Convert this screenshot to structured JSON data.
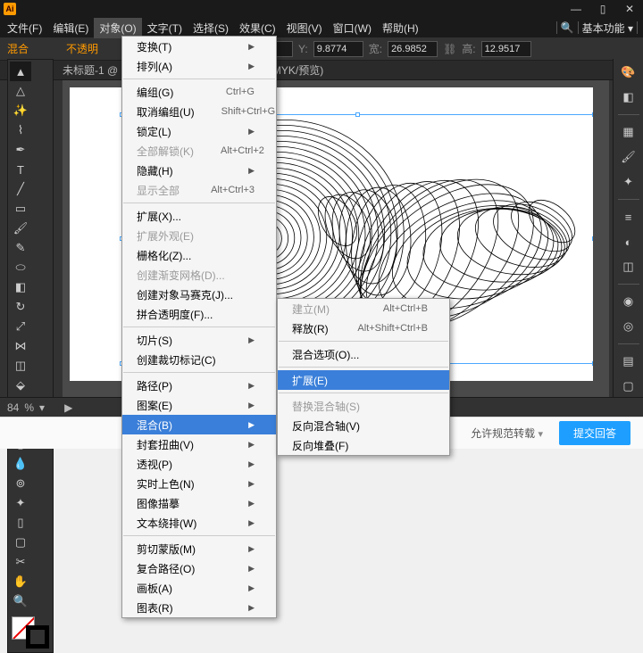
{
  "app": {
    "logo": "Ai"
  },
  "menubar": {
    "items": [
      "文件(F)",
      "编辑(E)",
      "对象(O)",
      "文字(T)",
      "选择(S)",
      "效果(C)",
      "视图(V)",
      "窗口(W)",
      "帮助(H)"
    ],
    "workspace": "基本功能"
  },
  "winctl": {
    "min": "—",
    "max": "▯",
    "close": "✕"
  },
  "optbar": {
    "blend_label": "混合",
    "opacity_label": "不透明",
    "x": "0805",
    "y": "9.8774",
    "w_lbl": "宽:",
    "w": "26.9852",
    "h_lbl": "高:",
    "h": "12.9517"
  },
  "doctab": {
    "title": "未标题-1 @",
    "view": "(CMYK/预览)"
  },
  "status": {
    "zoom": "84",
    "tool": "▶"
  },
  "menu1": [
    {
      "t": "row",
      "label": "变换(T)",
      "arrow": true
    },
    {
      "t": "row",
      "label": "排列(A)",
      "arrow": true
    },
    {
      "t": "sep"
    },
    {
      "t": "row",
      "label": "编组(G)",
      "sc": "Ctrl+G"
    },
    {
      "t": "row",
      "label": "取消编组(U)",
      "sc": "Shift+Ctrl+G"
    },
    {
      "t": "row",
      "label": "锁定(L)",
      "arrow": true
    },
    {
      "t": "row",
      "label": "全部解锁(K)",
      "disabled": true,
      "sc": "Alt+Ctrl+2"
    },
    {
      "t": "row",
      "label": "隐藏(H)",
      "arrow": true
    },
    {
      "t": "row",
      "label": "显示全部",
      "disabled": true,
      "sc": "Alt+Ctrl+3"
    },
    {
      "t": "sep"
    },
    {
      "t": "row",
      "label": "扩展(X)..."
    },
    {
      "t": "row",
      "label": "扩展外观(E)",
      "disabled": true
    },
    {
      "t": "row",
      "label": "栅格化(Z)..."
    },
    {
      "t": "row",
      "label": "创建渐变网格(D)...",
      "disabled": true
    },
    {
      "t": "row",
      "label": "创建对象马赛克(J)..."
    },
    {
      "t": "row",
      "label": "拼合透明度(F)..."
    },
    {
      "t": "sep"
    },
    {
      "t": "row",
      "label": "切片(S)",
      "arrow": true
    },
    {
      "t": "row",
      "label": "创建裁切标记(C)"
    },
    {
      "t": "sep"
    },
    {
      "t": "row",
      "label": "路径(P)",
      "arrow": true
    },
    {
      "t": "row",
      "label": "图案(E)",
      "arrow": true
    },
    {
      "t": "row",
      "label": "混合(B)",
      "arrow": true,
      "hover": true
    },
    {
      "t": "row",
      "label": "封套扭曲(V)",
      "arrow": true
    },
    {
      "t": "row",
      "label": "透视(P)",
      "arrow": true
    },
    {
      "t": "row",
      "label": "实时上色(N)",
      "arrow": true
    },
    {
      "t": "row",
      "label": "图像描摹",
      "arrow": true
    },
    {
      "t": "row",
      "label": "文本绕排(W)",
      "arrow": true
    },
    {
      "t": "sep"
    },
    {
      "t": "row",
      "label": "剪切蒙版(M)",
      "arrow": true
    },
    {
      "t": "row",
      "label": "复合路径(O)",
      "arrow": true
    },
    {
      "t": "row",
      "label": "画板(A)",
      "arrow": true
    },
    {
      "t": "row",
      "label": "图表(R)",
      "arrow": true
    }
  ],
  "menu2": [
    {
      "t": "row",
      "label": "建立(M)",
      "disabled": true,
      "sc": "Alt+Ctrl+B"
    },
    {
      "t": "row",
      "label": "释放(R)",
      "sc": "Alt+Shift+Ctrl+B"
    },
    {
      "t": "sep"
    },
    {
      "t": "row",
      "label": "混合选项(O)..."
    },
    {
      "t": "sep"
    },
    {
      "t": "row",
      "label": "扩展(E)",
      "hover": true
    },
    {
      "t": "sep"
    },
    {
      "t": "row",
      "label": "替换混合轴(S)",
      "disabled": true
    },
    {
      "t": "row",
      "label": "反向混合轴(V)"
    },
    {
      "t": "row",
      "label": "反向堆叠(F)"
    }
  ],
  "bottom": {
    "allow": "允许规范转载",
    "submit": "提交回答"
  }
}
